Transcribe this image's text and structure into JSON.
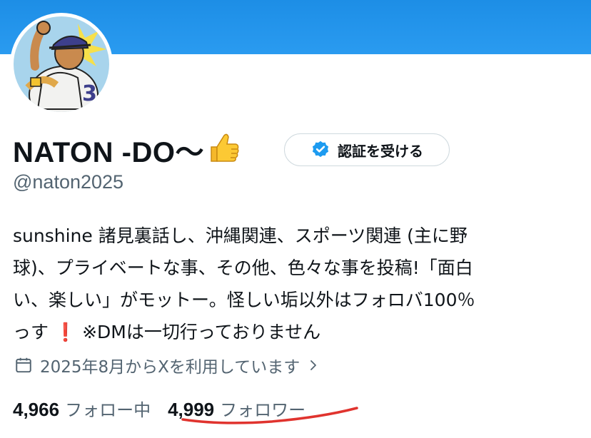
{
  "profile": {
    "display_name": "NATON -DO〜",
    "emoji": "thumbs-up-icon",
    "handle": "@naton2025",
    "verify_button_label": "認証を受ける",
    "bio_lines": [
      "sunshine 諸見裏話し、沖縄関連、スポーツ関連 (主に野",
      "球)、プライベートな事、その他、色々な事を投稿!「面白",
      "い、楽しい」がモットー。怪しい垢以外はフォロバ100％",
      "っす",
      "※DMは一切行っておりません"
    ],
    "bio_exclaim": "❗",
    "joined_text": "2025年8月からXを利用しています",
    "stats": {
      "following_count": "4,966",
      "following_label": "フォロー中",
      "followers_count": "4,999",
      "followers_label": "フォロワー"
    }
  },
  "colors": {
    "banner": "#1d8ee6",
    "verified_badge": "#1d9bf0",
    "secondary_text": "#536471",
    "annotation_underline": "#e0332e"
  }
}
